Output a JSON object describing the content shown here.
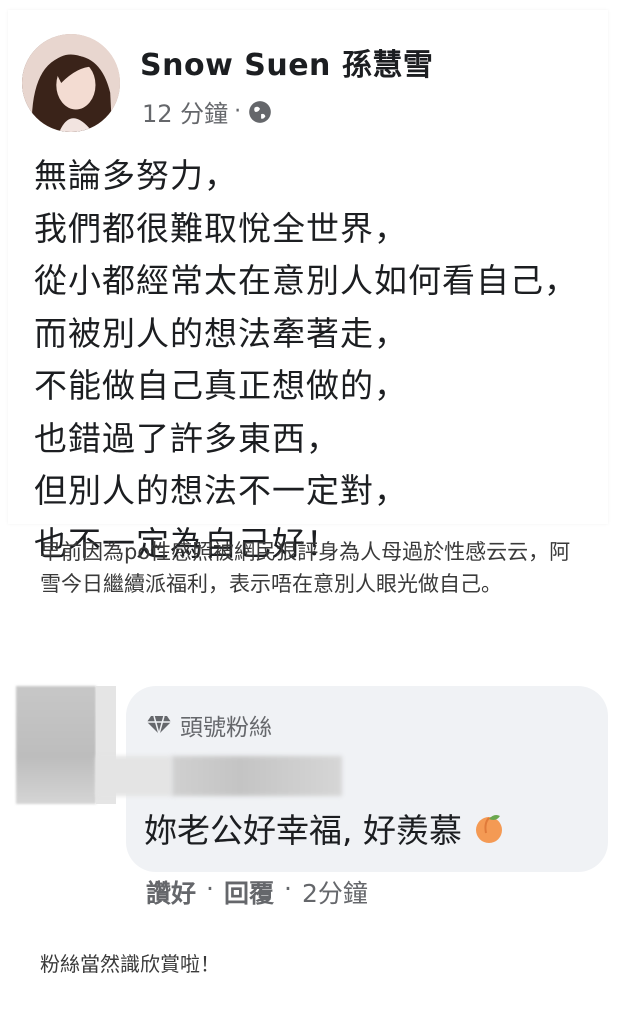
{
  "post": {
    "author": "Snow Suen 孫慧雪",
    "time": "12 分鐘",
    "separator": "·",
    "lines": [
      "無論多努力，",
      "我們都很難取悅全世界，",
      "從小都經常太在意別人如何看自己，",
      "而被別人的想法牽著走，",
      "不能做自己真正想做的，",
      "也錯過了許多東西，",
      "但別人的想法不一定對，",
      "也不一定為自己好！"
    ]
  },
  "caption": "早前因為po性感照被網民狠評身為人母過於性感云云，阿雪今日繼續派福利，表示唔在意別人眼光做自己。",
  "comment": {
    "badge": "頭號粉絲",
    "text": "妳老公好幸福, 好羨慕",
    "like": "讚好",
    "reply": "回覆",
    "time": "2分鐘",
    "separator": "·"
  },
  "footer_note": "粉絲當然識欣賞啦！",
  "colors": {
    "text": "#1c1e21",
    "meta": "#65676b",
    "bubble": "#f0f2f5"
  }
}
